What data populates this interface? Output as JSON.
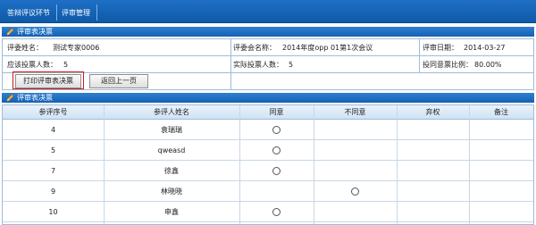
{
  "nav": {
    "tab1": "答辩评议环节",
    "tab2": "评审管理"
  },
  "section1": {
    "title": "评审表决票"
  },
  "info": {
    "committee_name_label": "评委姓名：",
    "committee_name_value": "测试专家0006",
    "meeting_label": "评委会名称：",
    "meeting_value": "2014年度opp 01第1次会议",
    "date_label": "评审日期：",
    "date_value": "2014-03-27",
    "should_count_label": "应该投票人数：",
    "should_count_value": "5",
    "actual_count_label": "实际投票人数：",
    "actual_count_value": "5",
    "ratio_label": "投同意票比例：",
    "ratio_value": "80.00%"
  },
  "buttons": {
    "print": "打印评审表决票",
    "back": "返回上一页"
  },
  "section2": {
    "title": "评审表决票"
  },
  "table": {
    "headers": [
      "参评序号",
      "参评人姓名",
      "同意",
      "不同意",
      "弃权",
      "备注"
    ],
    "rows": [
      {
        "no": "4",
        "name": "袁瑞瑞",
        "choice": "agree"
      },
      {
        "no": "5",
        "name": "qweasd",
        "choice": "agree"
      },
      {
        "no": "7",
        "name": "徐鑫",
        "choice": "agree"
      },
      {
        "no": "9",
        "name": "林晓晓",
        "choice": "disagree"
      },
      {
        "no": "10",
        "name": "申鑫",
        "choice": "agree"
      }
    ]
  }
}
